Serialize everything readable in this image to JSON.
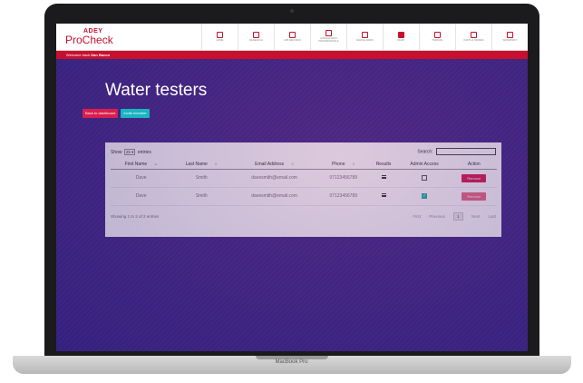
{
  "device": {
    "brand_label": "MacBook Pro"
  },
  "app": {
    "brand_top": "ADEY",
    "brand_name": "ProCheck"
  },
  "nav": {
    "items": [
      {
        "label": "HOME",
        "icon": "home-icon"
      },
      {
        "label": "RESEARCH",
        "icon": "research-icon"
      },
      {
        "label": "JOB RECORDS",
        "icon": "records-icon"
      },
      {
        "label": "MAGNACLEAN PROFESSIONALS",
        "icon": "magnaclean-icon"
      },
      {
        "label": "DEVICE ADMIN",
        "icon": "device-icon"
      },
      {
        "label": "DIARY",
        "icon": "diary-icon"
      },
      {
        "label": "TRAINING",
        "icon": "training-icon"
      },
      {
        "label": "PARTS & SPARES",
        "icon": "parts-icon"
      },
      {
        "label": "WATERTEST",
        "icon": "watertest-icon"
      }
    ]
  },
  "welcome": {
    "prefix": "Welcome back",
    "user": "Dan Bacon"
  },
  "page": {
    "title": "Water testers"
  },
  "buttons": {
    "back": "Back to dashboard",
    "invite": "Invite member"
  },
  "table_controls": {
    "show": "Show",
    "entries_value": "25",
    "entries": "entries",
    "search_label": "Search:"
  },
  "table": {
    "columns": [
      "First Name",
      "Last Name",
      "Email Address",
      "Phone",
      "Results",
      "Admin Access",
      "Action"
    ],
    "rows": [
      {
        "first": "Dave",
        "last": "Smith",
        "email": "davesmith@email.com",
        "phone": "07123456789",
        "admin": false,
        "action": "Remove"
      },
      {
        "first": "Dave",
        "last": "Smith",
        "email": "davesmith@email.com",
        "phone": "07123456789",
        "admin": true,
        "action": "Remove"
      }
    ]
  },
  "footer": {
    "info": "Showing 1 to 2 of 2 entries",
    "first": "First",
    "previous": "Previous",
    "current": "1",
    "next": "Next",
    "last": "Last"
  },
  "colors": {
    "brand_red": "#c8102e",
    "button_red": "#d91e4e",
    "teal": "#19b5c2",
    "background_purple": "#3b2a8a"
  }
}
